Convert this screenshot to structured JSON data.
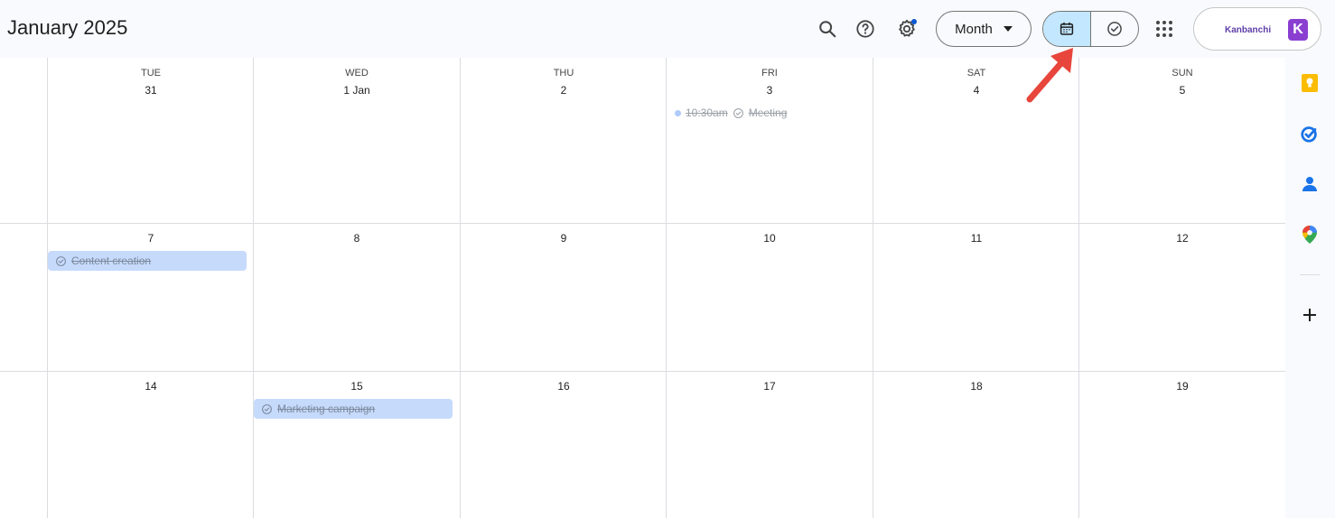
{
  "header": {
    "title": "January 2025",
    "view_label": "Month",
    "account_brand": "Kanbanchi",
    "account_badge": "K"
  },
  "toolbar": {
    "icons": [
      "search-icon",
      "help-icon",
      "settings-icon",
      "calendar-icon",
      "tasks-icon",
      "apps-grid-icon"
    ]
  },
  "calendar": {
    "weekdays": [
      "TUE",
      "WED",
      "THU",
      "FRI",
      "SAT",
      "SUN"
    ],
    "week1": [
      "31",
      "1 Jan",
      "2",
      "3",
      "4",
      "5"
    ],
    "week2": [
      "7",
      "8",
      "9",
      "10",
      "11",
      "12"
    ],
    "week3": [
      "14",
      "15",
      "16",
      "17",
      "18",
      "19"
    ],
    "events": {
      "fri3_time": "10:30am",
      "fri3_title": "Meeting",
      "tue7_title": "Content creation",
      "wed15_title": "Marketing campaign"
    }
  },
  "sidepanel": {
    "icons": [
      "keep-icon",
      "tasks-icon",
      "contacts-icon",
      "maps-icon",
      "add-icon"
    ]
  },
  "colors": {
    "accent": "#c2e7ff",
    "event_bg": "#c6dafc",
    "arrow": "#e8453c"
  }
}
